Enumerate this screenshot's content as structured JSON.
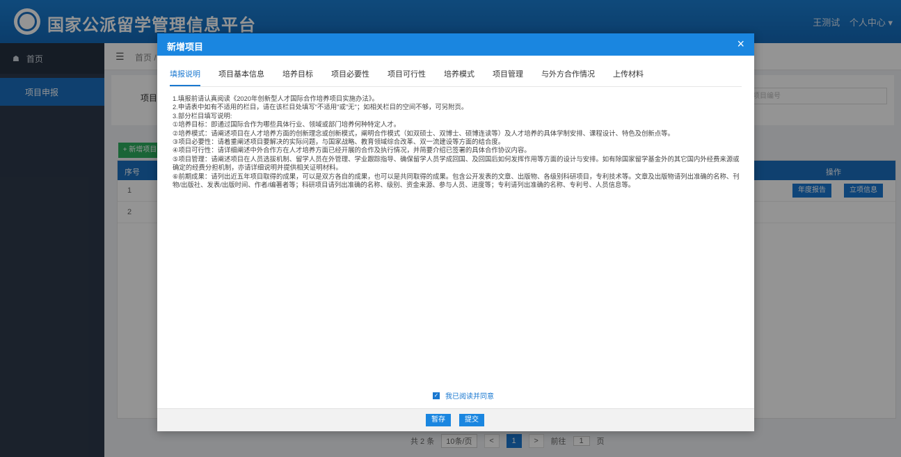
{
  "header": {
    "app_title": "国家公派留学管理信息平台",
    "user_name": "王测试",
    "user_center": "个人中心"
  },
  "sidebar": {
    "home": "首页",
    "items": [
      {
        "label": "项目申报"
      }
    ]
  },
  "background": {
    "breadcrumb": "首页 /",
    "filter_label": "项目名",
    "filter_placeholder": "项目编号",
    "add_button": "+ 新增项目",
    "table": {
      "col_index": "序号",
      "col_ops": "操作",
      "rows": [
        {
          "index": "1",
          "btn_report": "年度报告",
          "btn_info": "立项信息"
        },
        {
          "index": "2"
        }
      ]
    },
    "pager": {
      "total": "共 2 条",
      "page_size": "10条/页",
      "prev": "<",
      "current": "1",
      "next": ">",
      "goto": "前往",
      "goto_value": "1",
      "page_unit": "页"
    }
  },
  "modal": {
    "title": "新增项目",
    "close": "×",
    "tabs": [
      "填报说明",
      "项目基本信息",
      "培养目标",
      "项目必要性",
      "项目可行性",
      "培养模式",
      "项目管理",
      "与外方合作情况",
      "上传材料"
    ],
    "active_tab": "填报说明",
    "instructions": [
      "1.填报前请认真阅读《2020年创新型人才国际合作培养项目实施办法》。",
      "2.申请表中如有不适用的栏目，请在该栏目处填写\"不适用\"或\"无\"；如相关栏目的空间不够，可另附页。",
      "3.部分栏目填写说明:",
      "①培养目标：即通过国际合作为哪些具体行业、领域或部门培养何种特定人才。",
      "②培养模式：请阐述项目在人才培养方面的创新理念或创新模式，阐明合作模式（如双硕士、双博士、硕博连读等）及人才培养的具体学制安排、课程设计、特色及创新点等。",
      "③项目必要性：请着重阐述项目要解决的实际问题，与国家战略、教育领域综合改革、双一流建设等方面的结合度。",
      "④项目可行性：请详细阐述中外合作方在人才培养方面已经开展的合作及执行情况，并简要介绍已签署的具体合作协议内容。",
      "⑤项目管理：请阐述项目在人员选拔机制、留学人员在外管理、学业跟踪指导、确保留学人员学成回国、及回国后如何发挥作用等方面的设计与安排。如有除国家留学基金外的其它国内外经费来源或确定的经费分担机制，亦请详细说明并提供相关证明材料。",
      "⑥前期成果：请列出近五年项目取得的成果，可以是双方各自的成果，也可以是共同取得的成果。包含公开发表的文章、出版物、各级别科研项目，专利技术等。文章及出版物请列出准确的名称、刊物/出版社、发表/出版时间、作者/编著者等；科研项目请列出准确的名称、级别、资金来源、参与人员、进度等；专利请列出准确的名称、专利号、人员信息等。"
    ],
    "agree_label": "我已阅读并同意",
    "save_button": "暂存",
    "submit_button": "提交"
  }
}
